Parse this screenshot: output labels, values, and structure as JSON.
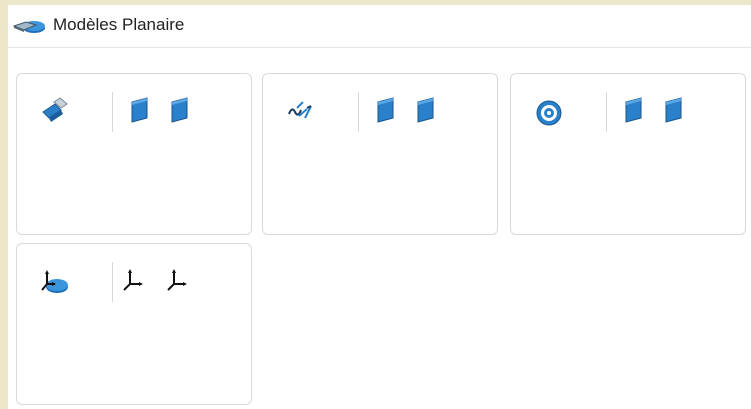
{
  "window": {
    "title": "Modèles Planaire",
    "title_icon": "planar-model-icon"
  },
  "panels": [
    {
      "main_icon": "planar-surface-icon",
      "sub_icons": [
        "blue-plane-icon",
        "blue-plane-icon"
      ]
    },
    {
      "main_icon": "planar-curve-icon",
      "sub_icons": [
        "blue-plane-icon",
        "blue-plane-icon"
      ]
    },
    {
      "main_icon": "concentric-target-icon",
      "sub_icons": [
        "blue-plane-icon",
        "blue-plane-icon"
      ]
    },
    {
      "main_icon": "workplane-axes-icon",
      "sub_icons": [
        "axis-triad-icon",
        "axis-triad-icon"
      ]
    }
  ],
  "colors": {
    "background": "#ece7c8",
    "accent_blue": "#1f78c8",
    "panel_border": "#d9d9d9"
  }
}
